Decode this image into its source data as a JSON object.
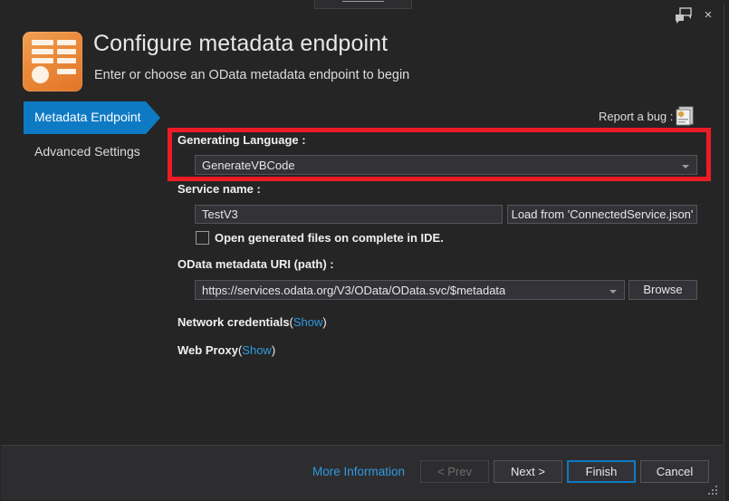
{
  "window": {
    "feedback_icon": "feedback-speech-bubble-icon",
    "close_icon": "×"
  },
  "header": {
    "icon": "odata-metadata-icon",
    "title": "Configure metadata endpoint",
    "subtitle": "Enter or choose an OData metadata endpoint to begin"
  },
  "nav": {
    "items": [
      {
        "label": "Metadata Endpoint",
        "selected": true
      },
      {
        "label": "Advanced Settings",
        "selected": false
      }
    ]
  },
  "report_bug": {
    "label": "Report a bug :",
    "icon": "bug-report-page-icon"
  },
  "form": {
    "generating_language": {
      "label": "Generating Language :",
      "value": "GenerateVBCode",
      "highlighted": true,
      "highlight_color": "#EE1C24"
    },
    "service_name": {
      "label": "Service name :",
      "value": "TestV3",
      "placeholder": ""
    },
    "load_button": {
      "label": "Load from 'ConnectedService.json'"
    },
    "open_generated_files": {
      "label": "Open generated files on complete in IDE.",
      "checked": false
    },
    "metadata_uri": {
      "label": "OData metadata URI (path) :",
      "value": "https://services.odata.org/V3/OData/OData.svc/$metadata"
    },
    "browse_button": {
      "label": "Browse"
    },
    "network_credentials": {
      "label": "Network credentials",
      "open_paren": "(",
      "link": "Show",
      "close_paren": ")"
    },
    "web_proxy": {
      "label": "Web Proxy",
      "open_paren": "(",
      "link": "Show",
      "close_paren": ")"
    }
  },
  "footer": {
    "more_information": "More Information",
    "prev": "< Prev",
    "next": "Next >",
    "finish": "Finish",
    "cancel": "Cancel"
  },
  "colors": {
    "accent_blue": "#0E7AC4",
    "link_blue": "#2F9AE0",
    "annotation_red": "#EE1C24",
    "icon_orange": "#EB8B3B",
    "window_bg": "#252526",
    "footer_bg": "#2D2D30"
  }
}
